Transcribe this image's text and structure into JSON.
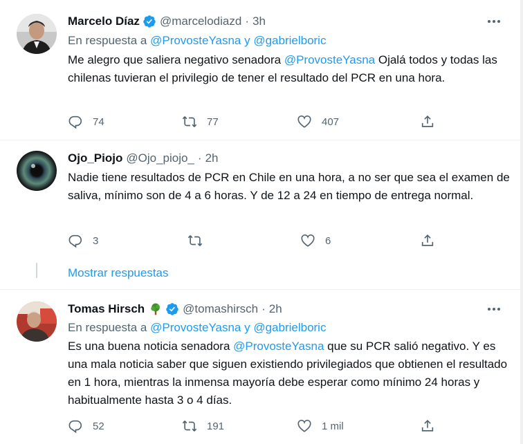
{
  "tweets": [
    {
      "name": "Marcelo Díaz",
      "handle": "@marcelodiazd",
      "time": "3h",
      "reply_prefix": "En respuesta a",
      "reply_mentions": "@ProvosteYasna y @gabrielboric",
      "text_before": "Me alegro que saliera negativo senadora ",
      "text_mention": "@ProvosteYasna",
      "text_after": " Ojalá todos y todas las chilenas tuvieran el privilegio de tener el resultado del PCR en una hora.",
      "replies": "74",
      "retweets": "77",
      "likes": "407"
    },
    {
      "name": "Ojo_Piojo",
      "handle": "@Ojo_piojo_",
      "time": "2h",
      "text": "Nadie tiene resultados de PCR en Chile en una hora, a no ser que sea el examen de saliva, mínimo son de 4 a 6 horas. Y de 12 a 24 en tiempo de entrega normal.",
      "replies": "3",
      "retweets": "",
      "likes": "6"
    },
    {
      "name": "Tomas Hirsch",
      "name_emoji": "🌳",
      "handle": "@tomashirsch",
      "time": "2h",
      "reply_prefix": "En respuesta a",
      "reply_mentions": "@ProvosteYasna y @gabrielboric",
      "text_before": "Es una buena noticia senadora ",
      "text_mention": "@ProvosteYasna",
      "text_after": " que su PCR salió negativo. Y es una mala noticia saber que siguen existiendo privilegiados que obtienen el resultado en 1 hora, mientras la inmensa mayoría debe esperar como mínimo 24 horas y habitualmente hasta 3 o 4 días.",
      "replies": "52",
      "retweets": "191",
      "likes": "1 mil"
    }
  ],
  "show_replies": "Mostrar respuestas",
  "icons": [
    "verified-icon",
    "more-icon",
    "reply-icon",
    "retweet-icon",
    "like-icon",
    "share-icon",
    "tree-emoji-icon"
  ],
  "colors": {
    "accent": "#1d9bf0",
    "secondary_text": "#536471",
    "text": "#0f1419",
    "divider": "#eff3f4"
  }
}
